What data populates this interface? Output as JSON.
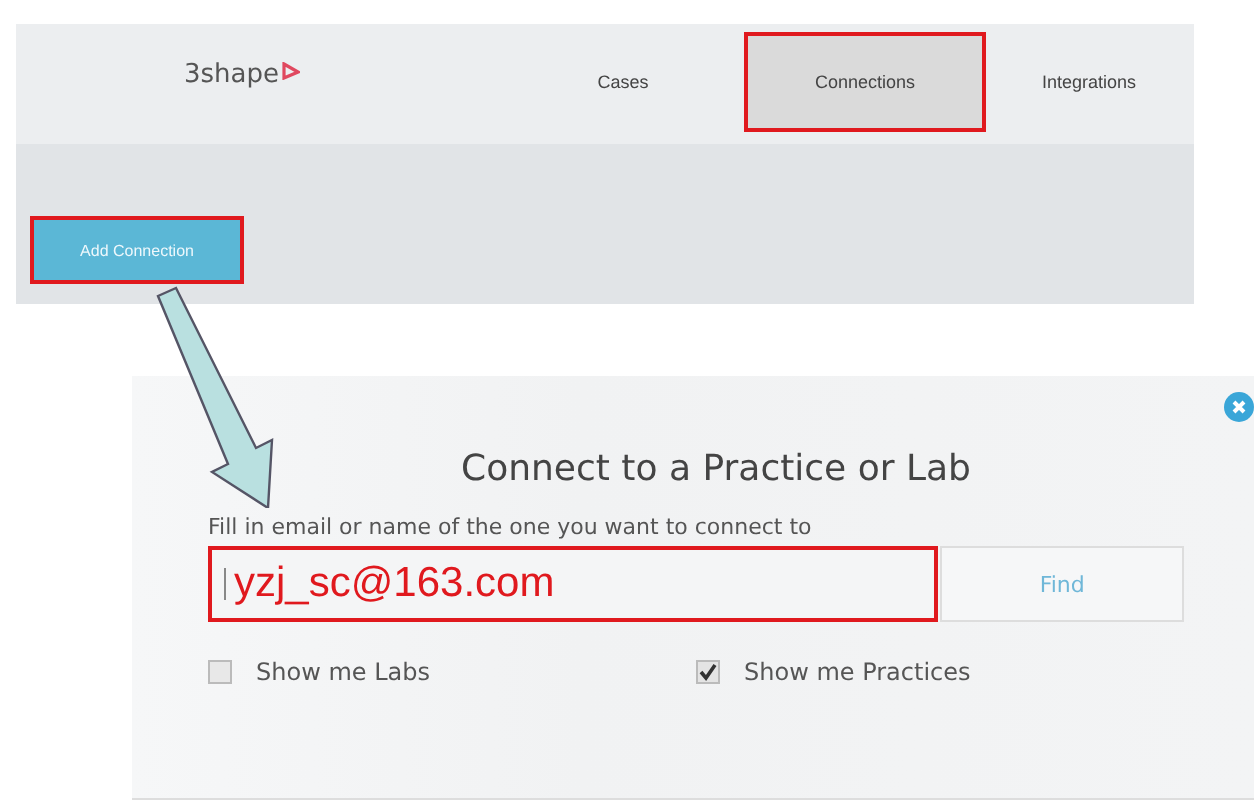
{
  "header": {
    "logo": "3shape",
    "tabs": [
      {
        "label": "Cases",
        "selected": false,
        "highlighted": false
      },
      {
        "label": "Connections",
        "selected": true,
        "highlighted": true
      },
      {
        "label": "Integrations",
        "selected": false,
        "highlighted": false
      }
    ]
  },
  "toolbar": {
    "add_button": {
      "label": "Add Connection",
      "highlighted": true
    }
  },
  "dialog": {
    "title": "Connect to a Practice or Lab",
    "field_label": "Fill in email or name of the one you want to connect to",
    "search": {
      "value": "yzj_sc@163.com",
      "highlighted": true
    },
    "find_button": "Find",
    "options": [
      {
        "label": "Show me Labs",
        "checked": false
      },
      {
        "label": "Show me Practices",
        "checked": true
      }
    ]
  }
}
